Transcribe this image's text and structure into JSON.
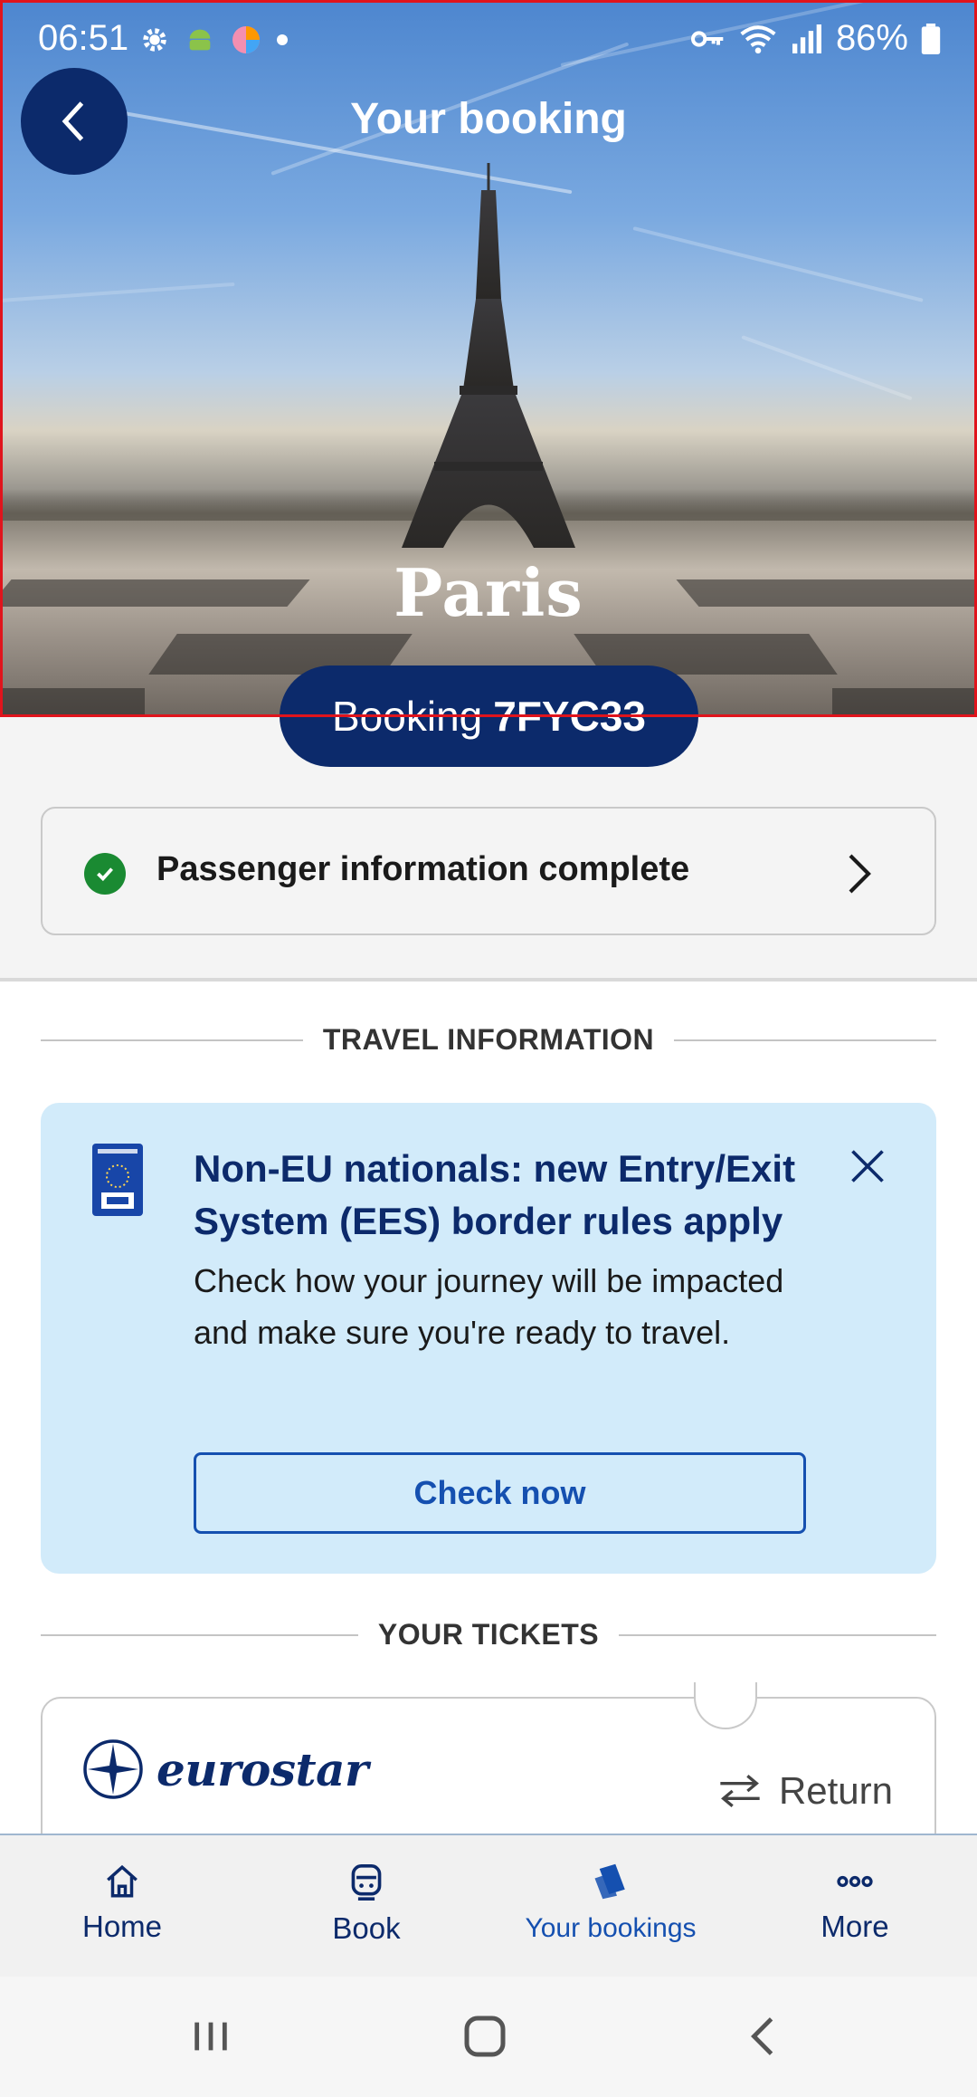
{
  "status_bar": {
    "time": "06:51",
    "battery": "86%"
  },
  "header": {
    "title": "Your booking",
    "city": "Paris"
  },
  "booking": {
    "label": "Booking",
    "reference": "7FYC33"
  },
  "passenger": {
    "status_text": "Passenger information complete"
  },
  "travel_info": {
    "heading": "TRAVEL INFORMATION",
    "banner": {
      "title": "Non-EU nationals: new Entry/Exit System (EES) border rules apply",
      "body": "Check how your journey will be impacted and make sure you're ready to travel.",
      "button": "Check now"
    }
  },
  "tickets": {
    "heading": "YOUR TICKETS",
    "brand": "eurostar",
    "trip_type": "Return"
  },
  "nav": {
    "items": [
      {
        "label": "Home",
        "icon": "home-icon"
      },
      {
        "label": "Book",
        "icon": "train-icon"
      },
      {
        "label": "Your bookings",
        "icon": "tickets-icon"
      },
      {
        "label": "More",
        "icon": "more-icon"
      }
    ],
    "active_index": 2
  },
  "colors": {
    "navy": "#0c2a6b",
    "accent_blue": "#1550b0",
    "banner_bg": "#d2ebfa",
    "success_green": "#1a8a32"
  }
}
